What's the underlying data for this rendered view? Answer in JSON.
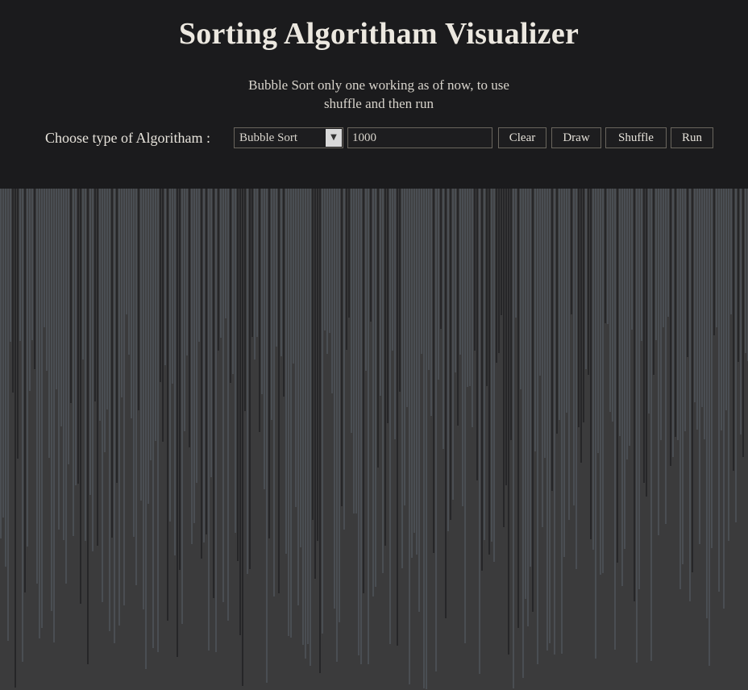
{
  "header": {
    "title": "Sorting Algoritham Visualizer",
    "subtitle_line1": "Bubble Sort only one working as of now, to use",
    "subtitle_line2": "shuffle and then run"
  },
  "controls": {
    "algorithm_label": "Choose type of Algoritham :",
    "algorithm_selected": "Bubble Sort",
    "count_value": "1000",
    "clear_label": "Clear",
    "draw_label": "Draw",
    "shuffle_label": "Shuffle",
    "run_label": "Run"
  },
  "colors": {
    "background": "#1b1b1d",
    "canvas_background": "#3b3b3c",
    "bar_light": "#4a4e53",
    "bar_dark": "#262628"
  }
}
